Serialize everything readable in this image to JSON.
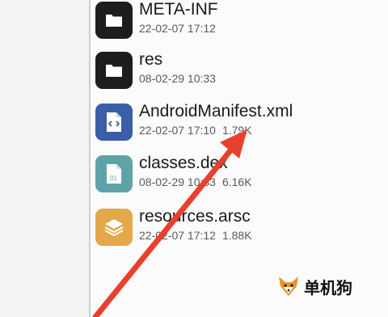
{
  "files": [
    {
      "name": "META-INF",
      "date": "22-02-07 17:12",
      "size": "",
      "icon": "folder-icon"
    },
    {
      "name": "res",
      "date": "08-02-29 10:33",
      "size": "",
      "icon": "folder-icon"
    },
    {
      "name": "AndroidManifest.xml",
      "date": "22-02-07 17:10",
      "size": "1.79K",
      "icon": "xml-file-icon"
    },
    {
      "name": "classes.dex",
      "date": "08-02-29 10:33",
      "size": "6.16K",
      "icon": "dex-file-icon"
    },
    {
      "name": "resources.arsc",
      "date": "22-02-07 17:12",
      "size": "1.88K",
      "icon": "layers-file-icon"
    }
  ],
  "watermark": {
    "text": "单机狗",
    "logo": "fox-logo"
  },
  "annotation": {
    "color": "#e8402f",
    "icon": "red-arrow-annotation"
  }
}
